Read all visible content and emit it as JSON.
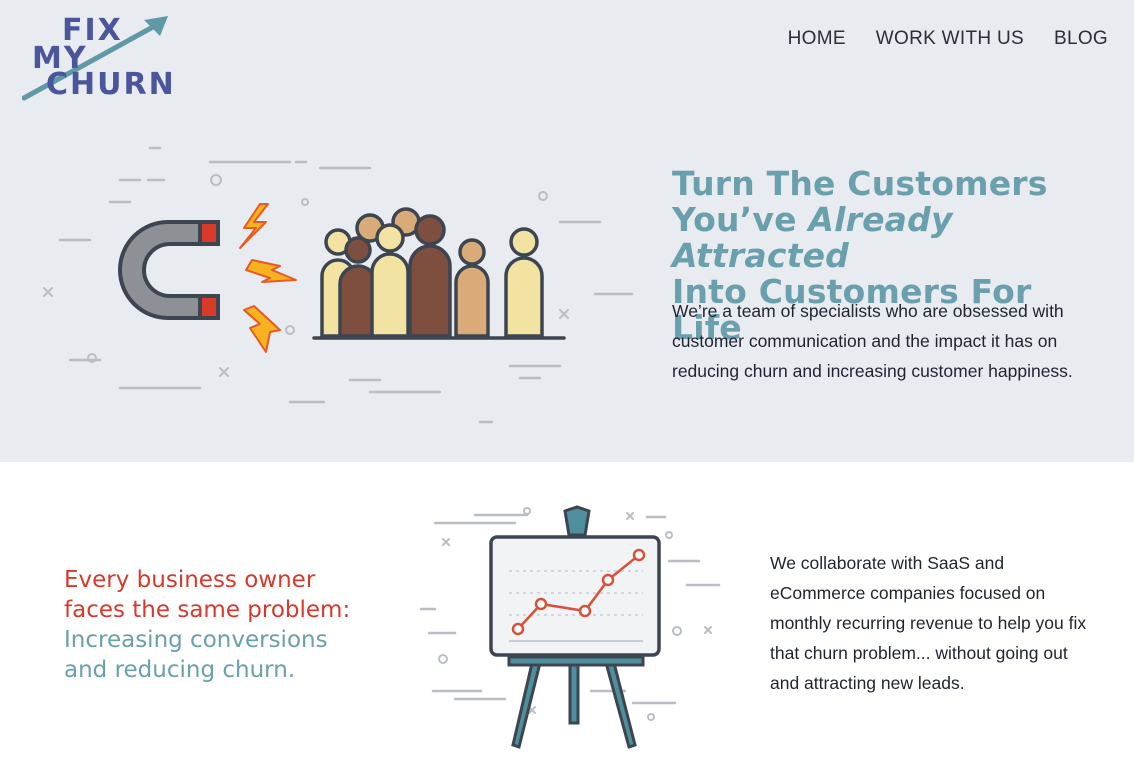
{
  "logo": {
    "line1": "FIX",
    "line2": "MY",
    "line3": "CHURN",
    "colors": {
      "text": "#4a559c",
      "arrow": "#5f98a6"
    }
  },
  "nav": {
    "items": [
      {
        "label": "HOME"
      },
      {
        "label": "WORK WITH US"
      },
      {
        "label": "BLOG"
      }
    ]
  },
  "hero": {
    "title_line1": "Turn The Customers",
    "title_line2_prefix": "You’ve ",
    "title_line2_em": "Already Attracted",
    "title_line3": "Into Customers For Life",
    "description": "We’re a team of specialists who are obsessed with customer communication and the impact it has on reducing churn and increasing customer happiness.",
    "illustration_icon": "magnet-attracting-people-icon",
    "background_color": "#e8ebef"
  },
  "problem": {
    "line_red_1": "Every business owner",
    "line_red_2": "faces the same problem:",
    "line_teal_1": "Increasing conversions",
    "line_teal_2": "and reducing churn.",
    "colors": {
      "red": "#d63a2c",
      "teal": "#6aa0ad"
    }
  },
  "collab": {
    "text": "We collaborate with SaaS and eCommerce companies focused on monthly recurring revenue to help you fix that churn problem... without going out and attracting new leads.",
    "illustration_icon": "easel-growth-chart-icon"
  }
}
